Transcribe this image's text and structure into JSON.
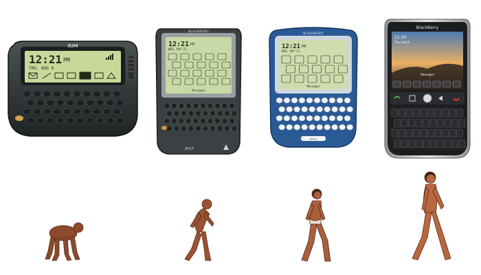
{
  "devices": [
    {
      "brand": "RIM",
      "screen_time": "12:21",
      "screen_ampm": "PM",
      "screen_date": "THU, AUG 9",
      "colors": {
        "body": "#2c3233",
        "screen": "#c9d79a",
        "key": "#1b1f20",
        "key_text": "#d8dcdc"
      }
    },
    {
      "brand": "BLACKBERRY",
      "screen_time": "12:21",
      "screen_ampm": "PM",
      "screen_date": "WED, MAY 21",
      "footer_label": "Messages",
      "carrier": "AT&T",
      "colors": {
        "body": "#3b4042",
        "screen": "#c9d8a7",
        "key": "#1e2223"
      }
    },
    {
      "brand": "BLACKBERRY",
      "screen_time": "12:21",
      "screen_ampm": "PM",
      "screen_date": "WED, MAY 21",
      "footer_label": "Messages",
      "space_label": "SPACE",
      "colors": {
        "body": "#2a5a96",
        "bezel": "#cfd6dd",
        "screen": "#cfdcae",
        "key": "#f2f4f6"
      }
    },
    {
      "brand": "BlackBerry",
      "screen_time": "11:20",
      "screen_date": "Thu, Aug 9",
      "footer_label": "Messages",
      "colors": {
        "body": "#1c1d1f",
        "chrome": "#c9ccd0",
        "sky_top": "#4d7ab1",
        "sky_bottom": "#e9b163",
        "key": "#2b2c2f"
      }
    }
  ],
  "figures": [
    {
      "stage": "quadruped-ape"
    },
    {
      "stage": "hunched-hominid"
    },
    {
      "stage": "early-human"
    },
    {
      "stage": "modern-human"
    }
  ],
  "skin_color": "#b25c3a"
}
